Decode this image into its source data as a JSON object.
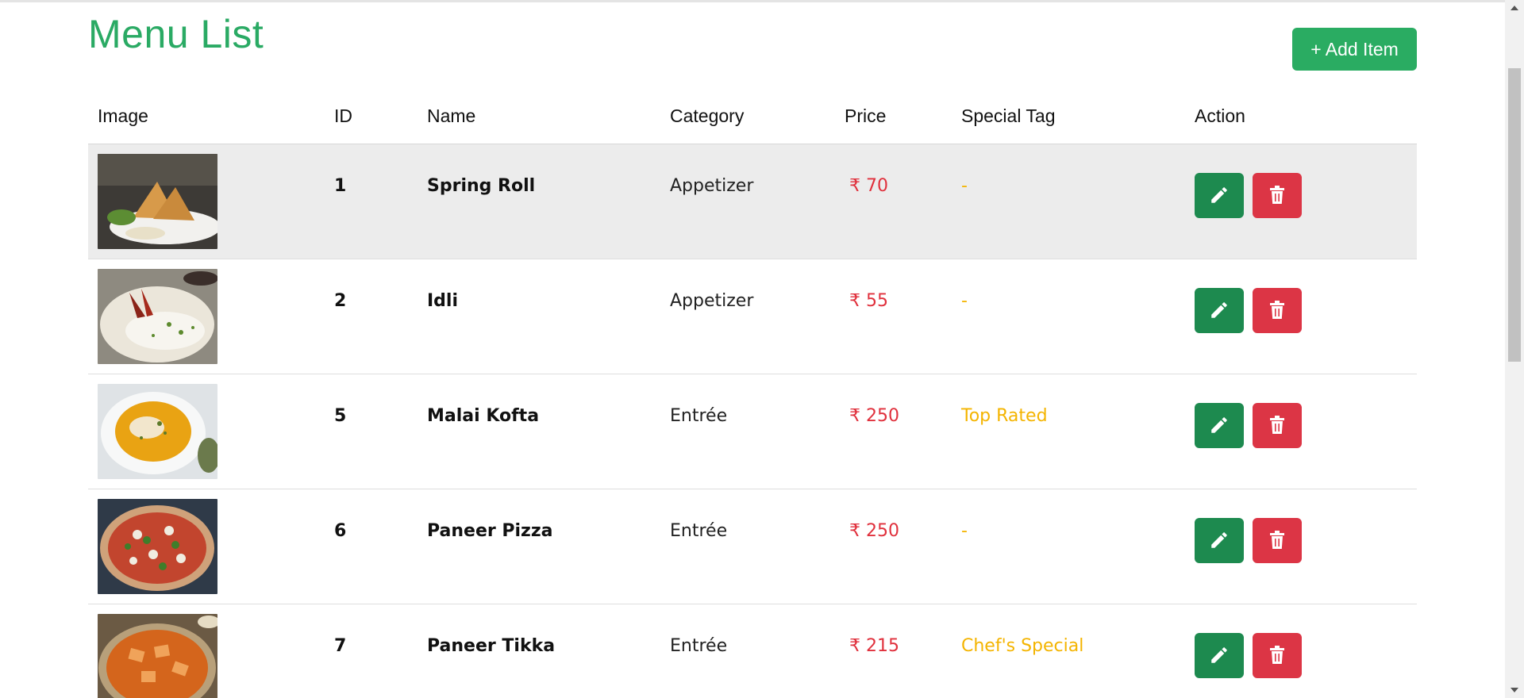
{
  "page": {
    "title": "Menu List",
    "add_button_label": "+ Add Item"
  },
  "table": {
    "headers": [
      "Image",
      "ID",
      "Name",
      "Category",
      "Price",
      "Special Tag",
      "Action"
    ],
    "rows": [
      {
        "id": "1",
        "name": "Spring Roll",
        "category": "Appetizer",
        "price": "₹ 70",
        "tag": "-"
      },
      {
        "id": "2",
        "name": "Idli",
        "category": "Appetizer",
        "price": "₹ 55",
        "tag": "-"
      },
      {
        "id": "5",
        "name": "Malai Kofta",
        "category": "Entrée",
        "price": "₹ 250",
        "tag": "Top Rated"
      },
      {
        "id": "6",
        "name": "Paneer Pizza",
        "category": "Entrée",
        "price": "₹ 250",
        "tag": "-"
      },
      {
        "id": "7",
        "name": "Paneer Tikka",
        "category": "Entrée",
        "price": "₹ 215",
        "tag": "Chef's Special"
      }
    ]
  },
  "icons": {
    "edit": "pencil-icon",
    "delete": "trash-icon"
  },
  "colors": {
    "accent": "#2aac62",
    "edit": "#1d8a4f",
    "delete": "#dc3545",
    "price": "#e0303c",
    "tag": "#f4b400"
  }
}
